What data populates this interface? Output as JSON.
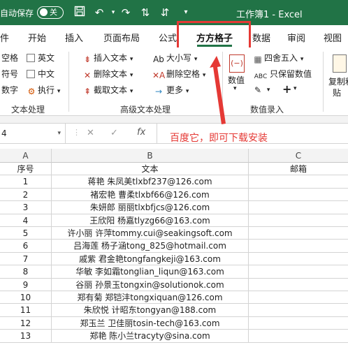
{
  "titlebar": {
    "autosave_label": "自动保存",
    "toggle_state": "关",
    "doc_title": "工作簿1  -  Excel"
  },
  "tabs": [
    {
      "label": "件"
    },
    {
      "label": "开始"
    },
    {
      "label": "插入"
    },
    {
      "label": "页面布局"
    },
    {
      "label": "公式"
    },
    {
      "label": "方方格子"
    },
    {
      "label": "数据"
    },
    {
      "label": "审阅"
    },
    {
      "label": "视图"
    }
  ],
  "ribbon": {
    "text_group": {
      "left_items": [
        "空格",
        "符号",
        "数字"
      ],
      "options": [
        "英文",
        "中文",
        "执行"
      ],
      "label": "文本处理"
    },
    "advanced_group": {
      "col1": [
        "插入文本",
        "删除文本",
        "截取文本"
      ],
      "col2": [
        "大小写",
        "删除空格",
        "更多"
      ],
      "label": "高级文本处理"
    },
    "data_group": {
      "big_button": "数值",
      "items": [
        "四舍五入",
        "只保留数值"
      ],
      "label": "数值录入"
    },
    "right_partial": {
      "line1": "复制粘",
      "line2": "贴"
    }
  },
  "formulabar": {
    "namebox": "4",
    "fx": "fx"
  },
  "annotation": "百度它，即可下载安装",
  "sheet": {
    "columns": [
      "A",
      "B",
      "C"
    ],
    "headers": [
      "序号",
      "文本",
      "邮箱"
    ],
    "rows": [
      [
        "1",
        "蒋艳 朱凤美tlxbf237@126.com"
      ],
      [
        "2",
        "褚宏艳 曹柔tlxbf66@126.com"
      ],
      [
        "3",
        "朱妍郎 丽丽tlxbfjcs@126.com"
      ],
      [
        "4",
        "王欣阳 杨嘉tlyzg66@163.com"
      ],
      [
        "5",
        "许小丽 许萍tommy.cui@seakingsoft.com"
      ],
      [
        "6",
        "吕海莲 杨子涵tong_825@hotmail.com"
      ],
      [
        "7",
        "戚紫 君金艳tongfangkeji@163.com"
      ],
      [
        "8",
        "华敏 李如霜tonglian_liqun@163.com"
      ],
      [
        "9",
        "谷丽 孙景玉tongxin@solutionok.com"
      ],
      [
        "10",
        "郑有菊 郑铠沣tongxiquan@126.com"
      ],
      [
        "11",
        "朱欣悦 计昭东tongyan@188.com"
      ],
      [
        "12",
        "郑玉兰 卫佳丽tosin-tech@163.com"
      ],
      [
        "13",
        "郑艳 陈小兰tracyty@sina.com"
      ]
    ]
  },
  "colors": {
    "excel_green": "#217346",
    "annotation_red": "#e53935"
  }
}
